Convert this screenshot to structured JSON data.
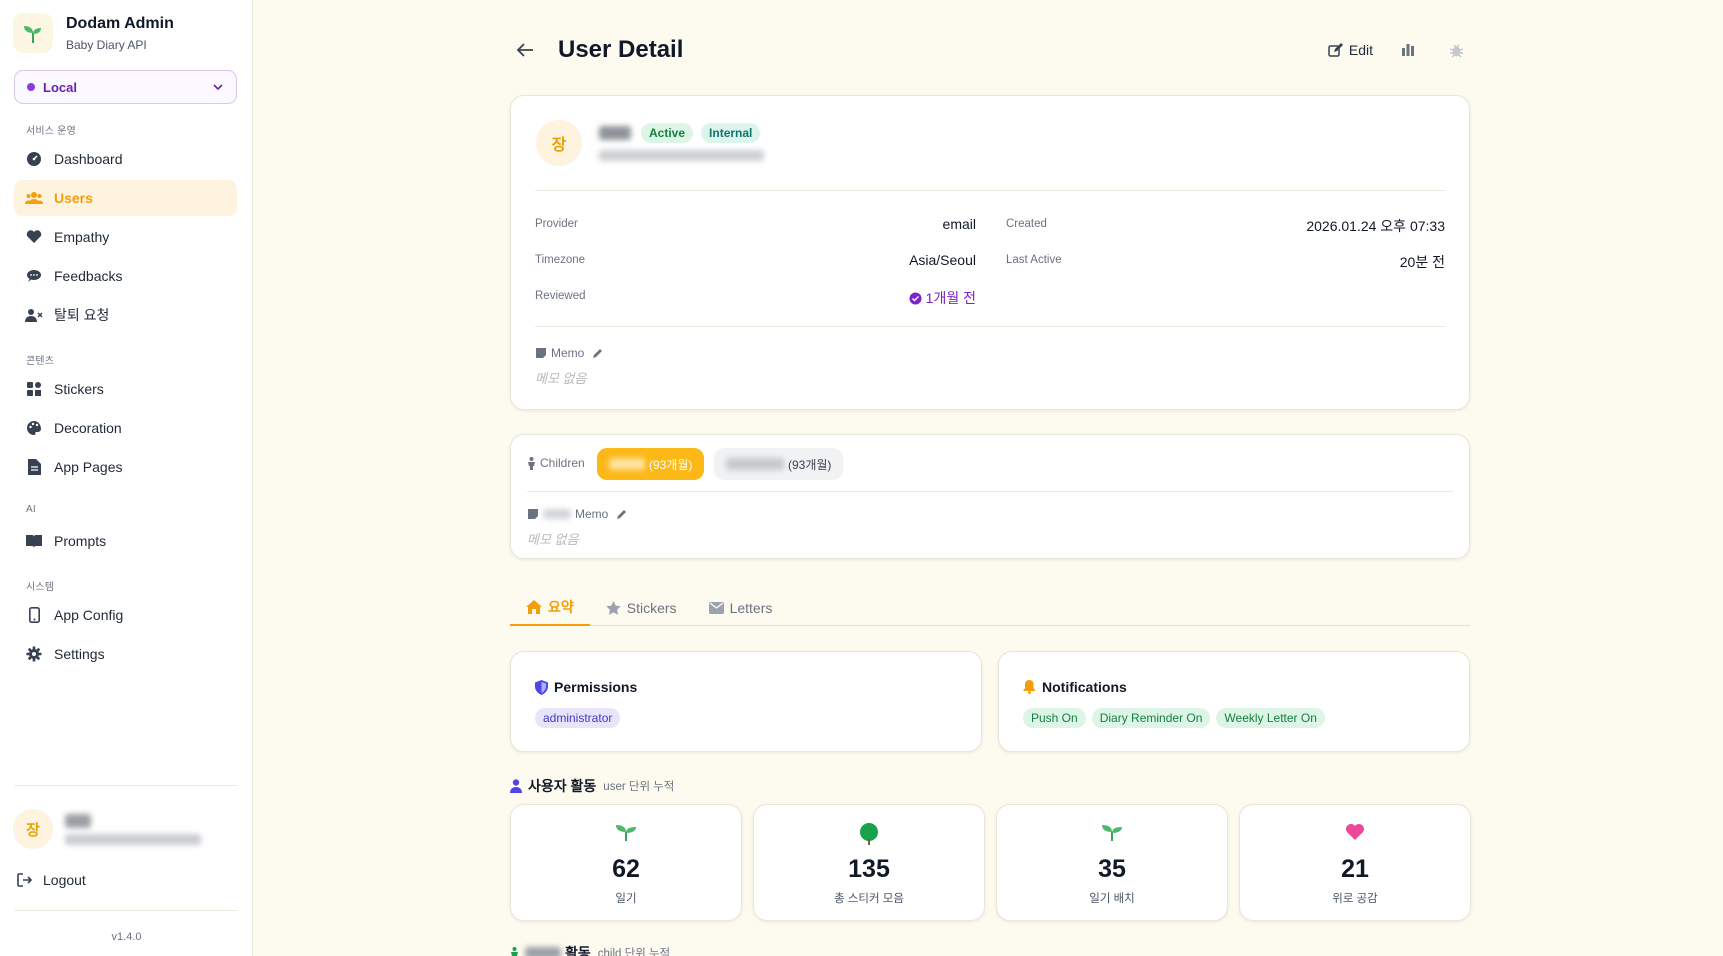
{
  "brand": {
    "title": "Dodam Admin",
    "subtitle": "Baby Diary API",
    "icon": "sprout-icon"
  },
  "env": {
    "selected": "Local",
    "accent": "#8b3ddb"
  },
  "sidebar": {
    "sections": [
      "서비스 운영",
      "콘텐츠",
      "AI",
      "시스템"
    ],
    "items": [
      {
        "label": "Dashboard",
        "icon": "dashboard-icon"
      },
      {
        "label": "Users",
        "icon": "users-icon",
        "active": true
      },
      {
        "label": "Empathy",
        "icon": "heart-icon"
      },
      {
        "label": "Feedbacks",
        "icon": "comment-icon"
      },
      {
        "label": "탈퇴 요청",
        "icon": "user-x-icon"
      },
      {
        "label": "Stickers",
        "icon": "sticker-icon"
      },
      {
        "label": "Decoration",
        "icon": "palette-icon"
      },
      {
        "label": "App Pages",
        "icon": "file-icon"
      },
      {
        "label": "Prompts",
        "icon": "book-icon"
      },
      {
        "label": "App Config",
        "icon": "phone-icon"
      },
      {
        "label": "Settings",
        "icon": "gear-icon"
      }
    ],
    "user_avatar": "장",
    "logout": "Logout",
    "version": "v1.4.0"
  },
  "header": {
    "title": "User Detail",
    "edit": "Edit"
  },
  "profile": {
    "avatar": "장",
    "badges": [
      "Active",
      "Internal"
    ],
    "provider_label": "Provider",
    "provider": "email",
    "timezone_label": "Timezone",
    "timezone": "Asia/Seoul",
    "reviewed_label": "Reviewed",
    "reviewed": "1개월 전",
    "created_label": "Created",
    "created": "2026.01.24 오후 07:33",
    "last_active_label": "Last Active",
    "last_active": "20분 전",
    "memo_label": "Memo",
    "memo_empty": "메모 없음"
  },
  "children": {
    "label": "Children",
    "chips": [
      {
        "age": "(93개월)",
        "active": true
      },
      {
        "age": "(93개월)",
        "active": false
      }
    ],
    "memo_label": "Memo",
    "memo_empty": "메모 없음"
  },
  "tabs": [
    {
      "label": "요약",
      "icon": "home-icon",
      "active": true
    },
    {
      "label": "Stickers",
      "icon": "star-icon"
    },
    {
      "label": "Letters",
      "icon": "mail-icon"
    }
  ],
  "permissions": {
    "title": "Permissions",
    "items": [
      "administrator"
    ]
  },
  "notifications": {
    "title": "Notifications",
    "items": [
      "Push On",
      "Diary Reminder On",
      "Weekly Letter On"
    ]
  },
  "user_activity": {
    "title": "사용자 활동",
    "subtitle": "user 단위 누적",
    "stats": [
      {
        "value": "62",
        "label": "일기",
        "icon": "sprout-icon"
      },
      {
        "value": "135",
        "label": "총 스티커 모음",
        "icon": "tree-icon"
      },
      {
        "value": "35",
        "label": "일기 배치",
        "icon": "sprout-icon"
      },
      {
        "value": "21",
        "label": "위로 공감",
        "icon": "heart-icon"
      }
    ]
  },
  "child_activity": {
    "title": "활동",
    "subtitle": "child 단위 누적"
  }
}
